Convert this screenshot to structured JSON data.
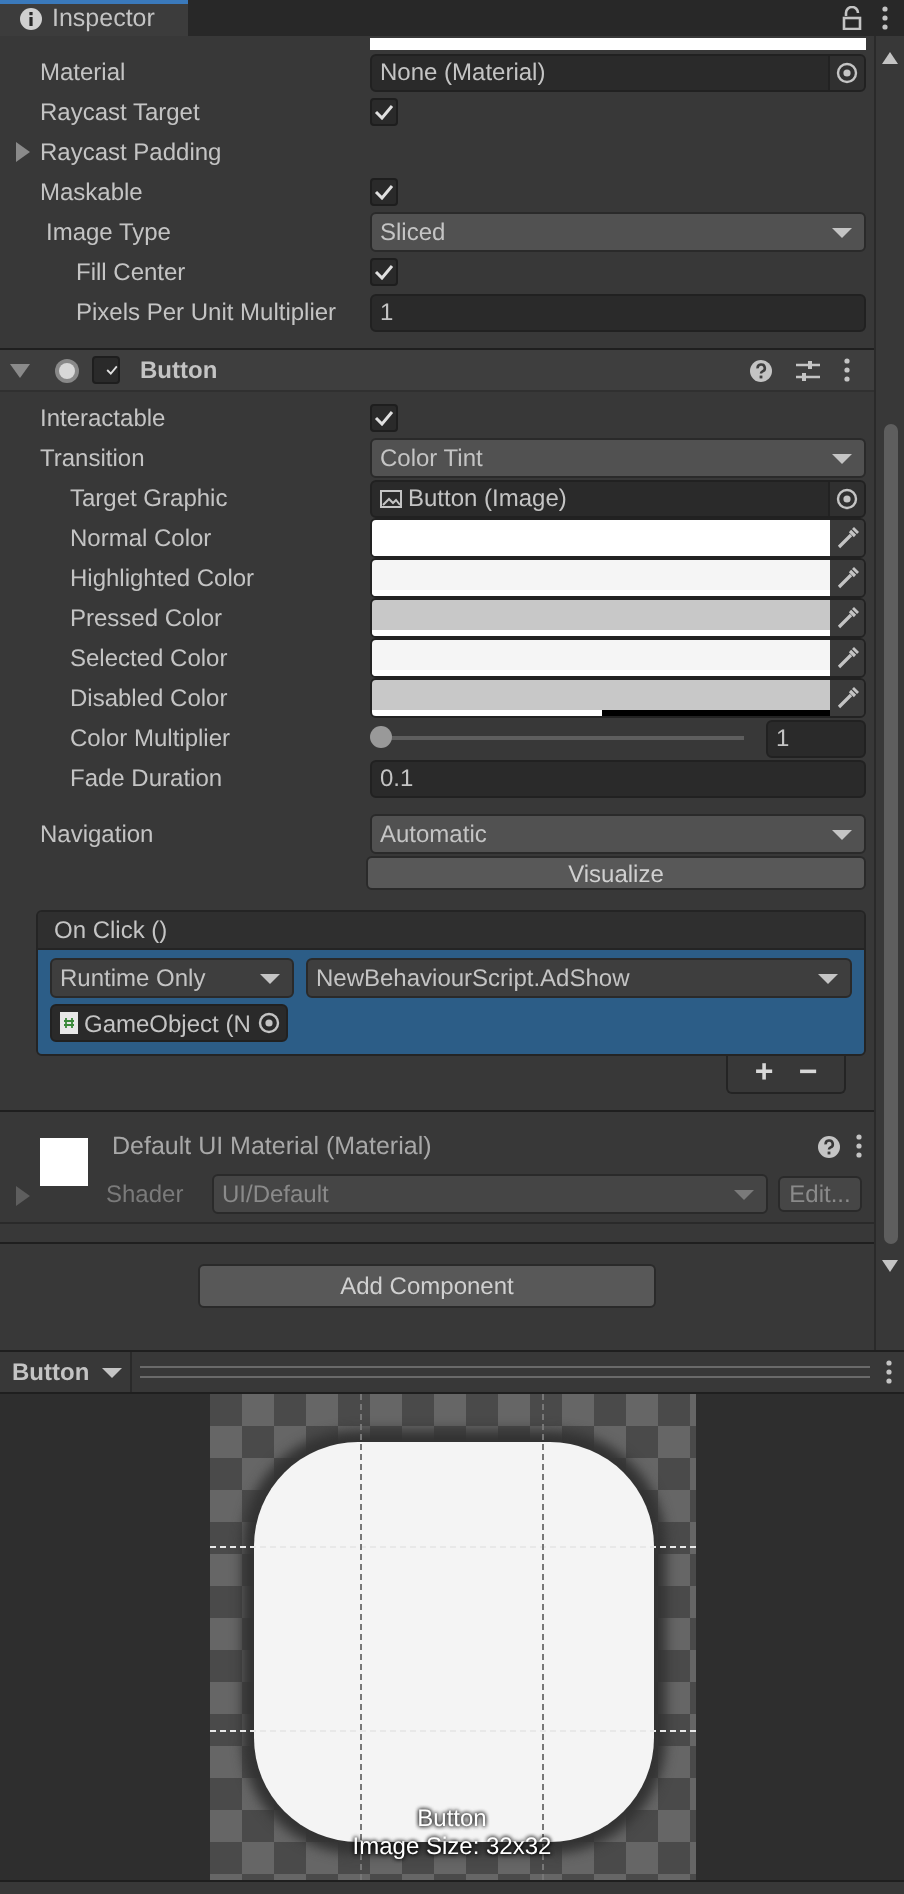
{
  "tab": {
    "title": "Inspector",
    "selected": true
  },
  "image_component": {
    "top_swatch": {
      "color": "#ffffff"
    },
    "props": [
      {
        "kind": "object",
        "label": "Material",
        "value": "None (Material)"
      },
      {
        "kind": "check",
        "label": "Raycast Target",
        "checked": true
      },
      {
        "kind": "foldout",
        "label": "Raycast Padding",
        "expanded": false
      },
      {
        "kind": "check",
        "label": "Maskable",
        "checked": true
      },
      {
        "kind": "dropdown",
        "label": "Image Type",
        "value": "Sliced",
        "children": [
          {
            "kind": "check",
            "label": "Fill Center",
            "checked": true
          },
          {
            "kind": "field",
            "label": "Pixels Per Unit Multiplier",
            "value": "1"
          }
        ]
      }
    ]
  },
  "button_component": {
    "title": "Button",
    "enabled": true,
    "expanded": true,
    "props": [
      {
        "kind": "check",
        "label": "Interactable",
        "checked": true
      },
      {
        "kind": "dropdown",
        "label": "Transition",
        "value": "Color Tint",
        "children": [
          {
            "kind": "graphic",
            "label": "Target Graphic",
            "value": "Button (Image)"
          },
          {
            "kind": "color",
            "label": "Normal Color",
            "color": "#ffffff",
            "level": 1
          },
          {
            "kind": "color",
            "label": "Highlighted Color",
            "color": "#f5f5f5",
            "level": 1
          },
          {
            "kind": "color",
            "label": "Pressed Color",
            "color": "#c8c8c8",
            "level": 1
          },
          {
            "kind": "color",
            "label": "Selected Color",
            "color": "#f5f5f5",
            "level": 1
          },
          {
            "kind": "color",
            "label": "Disabled Color",
            "color": "#c8c8c8",
            "level": 0.5
          },
          {
            "kind": "slider",
            "label": "Color Multiplier",
            "level": 0,
            "reading": "1"
          },
          {
            "kind": "field",
            "label": "Fade Duration",
            "value": "0.1"
          }
        ]
      }
    ],
    "navigation": {
      "label": "Navigation",
      "value": "Automatic"
    },
    "visualize": "Visualize",
    "event": {
      "title": "On Click ()",
      "entries": [
        {
          "mode": "Runtime Only",
          "target": "GameObject (N",
          "function": "NewBehaviourScript.AdShow",
          "selected": true
        }
      ],
      "add": "+",
      "remove": "−"
    }
  },
  "material": {
    "title": "Default UI Material (Material)",
    "shader_label": "Shader",
    "shader": "UI/Default",
    "edit": "Edit..."
  },
  "add_component": "Add Component",
  "preview": {
    "dropdown": "Button",
    "caption": "Button",
    "size": "Image Size: 32x32"
  }
}
